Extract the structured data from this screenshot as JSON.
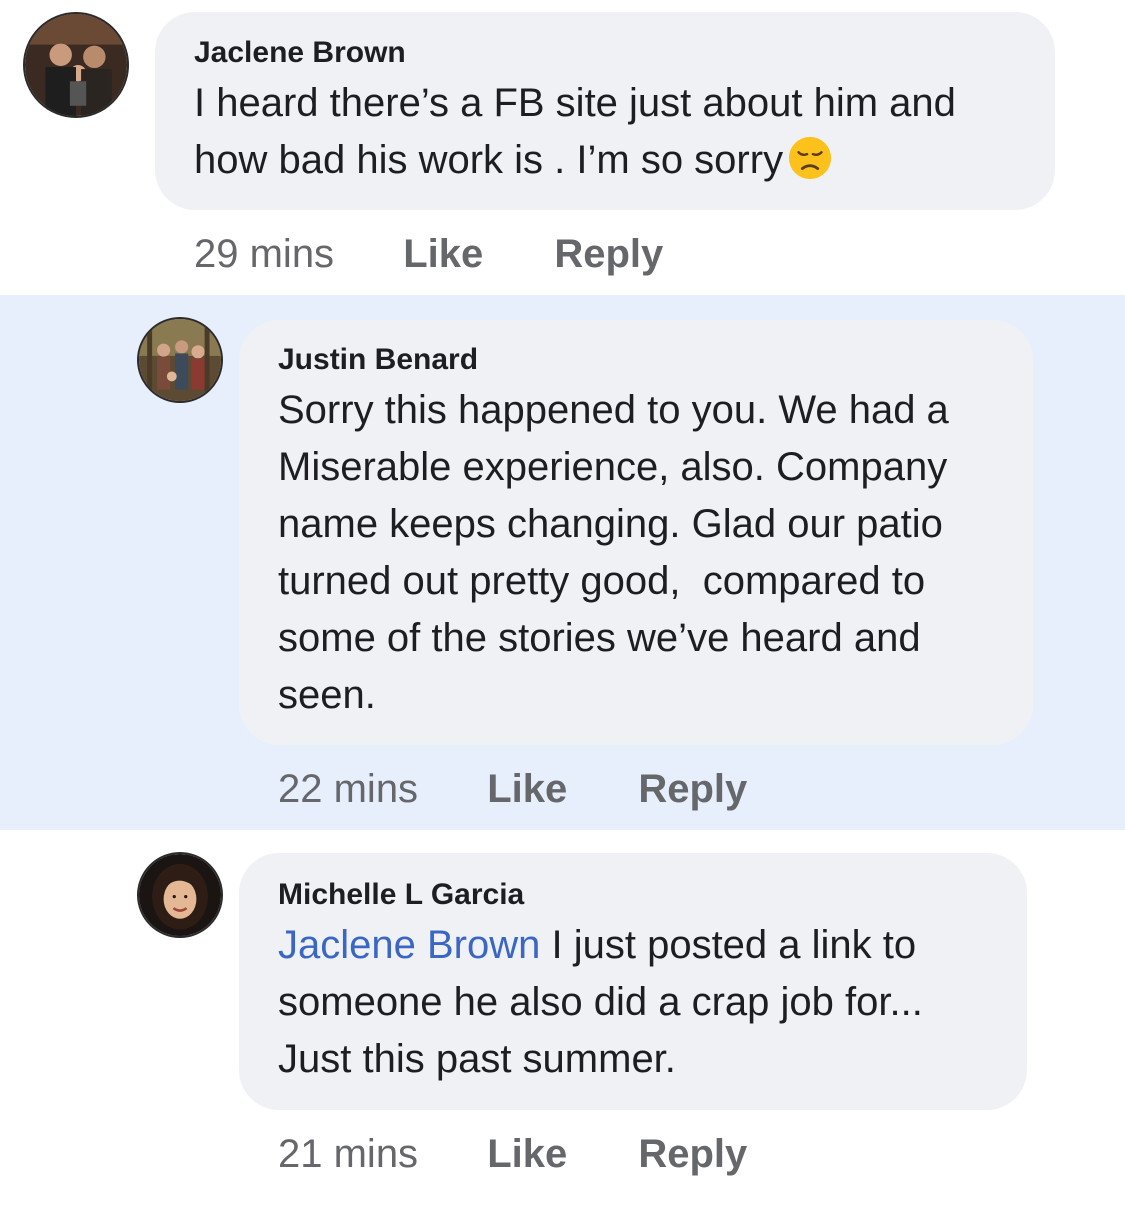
{
  "comments": [
    {
      "author": "Jaclene Brown",
      "text_lines": [
        "I heard there’s a FB site just about him and",
        "how bad his work is . I’m so sorry"
      ],
      "emoji": "disappointed-face-icon",
      "time": "29 mins",
      "like_label": "Like",
      "reply_label": "Reply",
      "highlighted": false
    },
    {
      "author": "Justin Benard",
      "text_lines": [
        "Sorry this happened to you. We had a",
        "Miserable experience, also. Company",
        "name keeps changing. Glad our patio",
        "turned out pretty good,  compared to",
        "some of the stories we’ve heard and",
        "seen."
      ],
      "time": "22 mins",
      "like_label": "Like",
      "reply_label": "Reply",
      "highlighted": true
    },
    {
      "author": "Michelle L Garcia",
      "mention": "Jaclene Brown",
      "text_lines": [
        " I just posted a link to",
        "someone he also did a crap job for...",
        "Just this past summer."
      ],
      "time": "21 mins",
      "like_label": "Like",
      "reply_label": "Reply",
      "highlighted": false
    }
  ],
  "colors": {
    "highlight_bg": "#e7effc",
    "bubble_bg": "#f0f1f5",
    "mention": "#3a66c4",
    "meta_text": "#65676b"
  }
}
